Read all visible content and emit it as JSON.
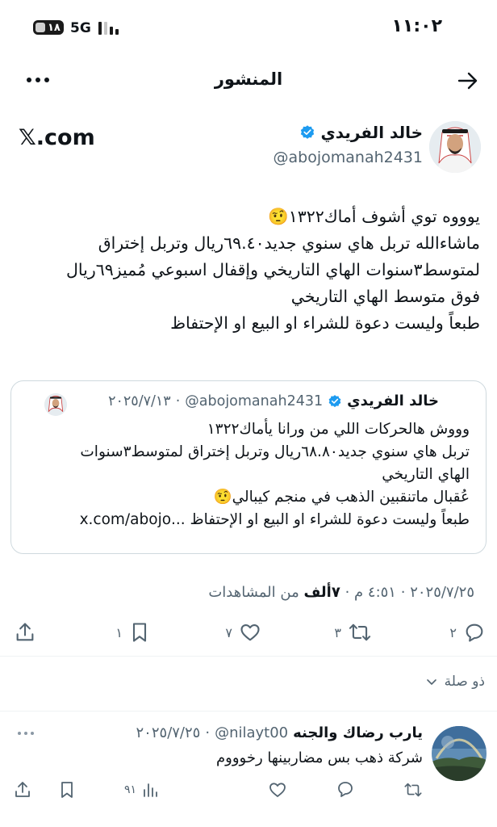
{
  "status_bar": {
    "time": "١١:٠٢",
    "battery": "١٨",
    "network": "5G"
  },
  "header": {
    "title": "المنشور"
  },
  "post": {
    "author_name": "خالد الفريدي",
    "author_handle": "@abojomanah2431",
    "source_label": "𝕏.com",
    "lines": [
      "يوووه توي أشوف أماك١٣٢٢🤨",
      "ماشاءالله تربل هاي سنوي جديد٦٩.٤٠ريال وتربل إختراق",
      "لمتوسط٣سنوات الهاي التاريخي وإقفال اسبوعي مُميز٦٩ريال",
      "فوق متوسط الهاي التاريخي",
      "طبعاً وليست دعوة للشراء او البيع او الإحتفاظ"
    ],
    "quote": {
      "author_name": "خالد الفريدي",
      "author_handle": "@abojomanah2431",
      "date": "٢٠٢٥/٧/١٣",
      "separator": "·",
      "lines": [
        "وووش هالحركات اللي من ورانا يأماك١٣٢٢",
        "تربل هاي سنوي جديد٦٨.٨٠ريال وتربل إختراق لمتوسط٣سنوات",
        "الهاي التاريخي",
        "عُقبال ماتنقبين الذهب في منجم كيبالي🤨",
        "طبعاً وليست دعوة للشراء او البيع او الإحتفاظ ...x.com/abojo"
      ]
    },
    "meta": {
      "time": "٤:٥١ م",
      "date": "٢٠٢٥/٧/٢٥",
      "separator": "·",
      "views_count": "٧ألف",
      "views_label": "من المشاهدات"
    },
    "actions": {
      "replies": "٢",
      "reposts": "٣",
      "likes": "٧",
      "bookmarks": "١"
    }
  },
  "thread_label": "ذو صلة",
  "reply": {
    "author_name": "يارب رضاك والجنه",
    "author_handle": "@nilayt00",
    "date": "٢٠٢٥/٧/٢٥",
    "separator": "·",
    "text": "شركة ذهب بس مضاربينها رخوووم",
    "views": "٩١"
  },
  "colors": {
    "text": "#0f1419",
    "secondary": "#536471",
    "verified": "#1d9bf0",
    "border": "#cfd9de"
  }
}
